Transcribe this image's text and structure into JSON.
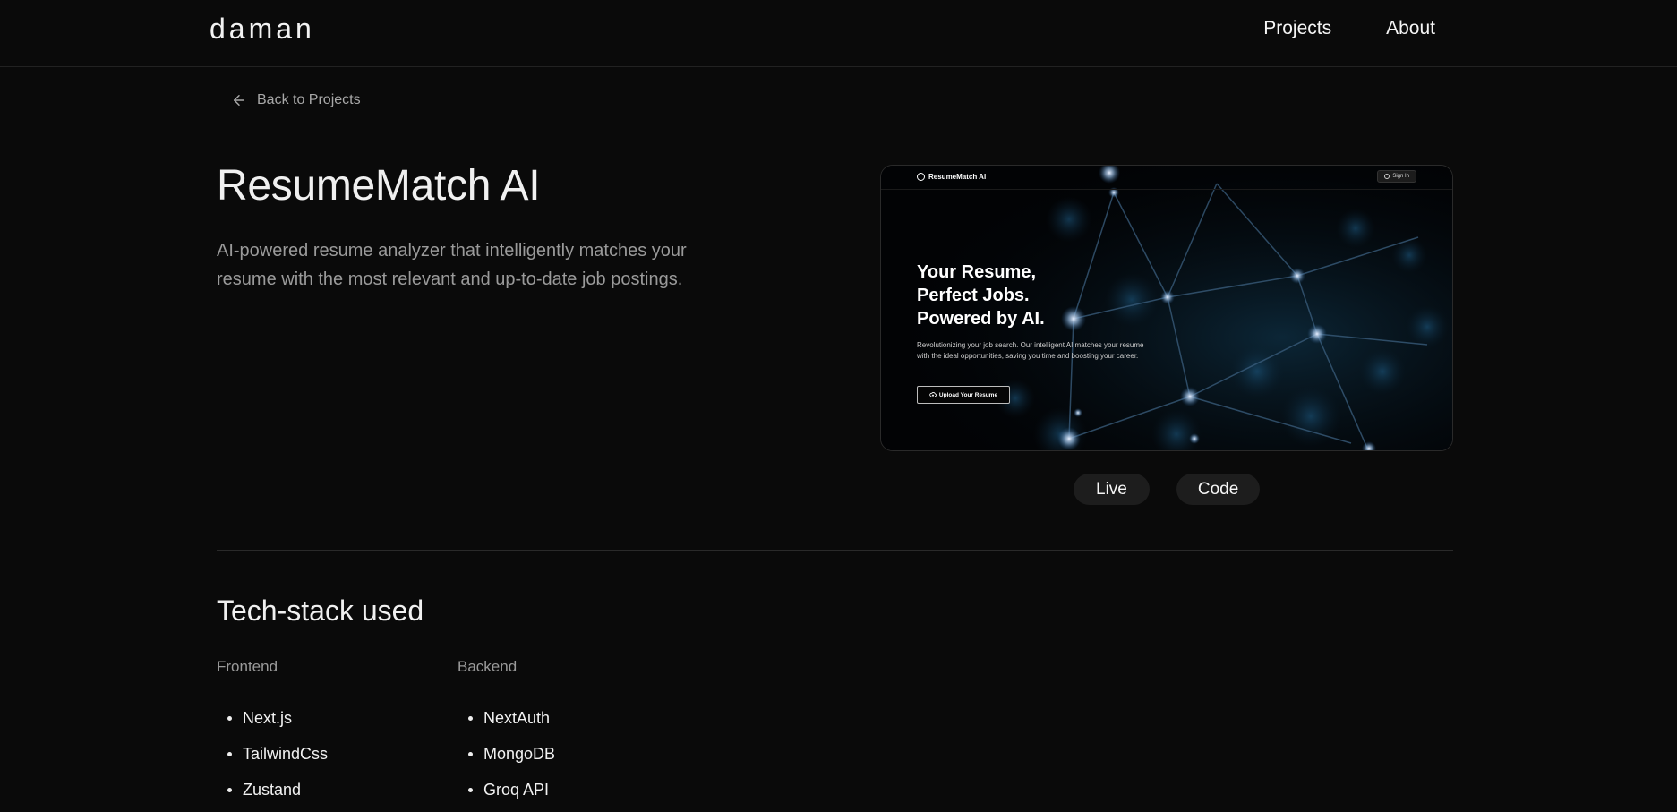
{
  "header": {
    "logo": "daman",
    "nav": [
      "Projects",
      "About"
    ]
  },
  "back_link": {
    "label": "Back to Projects",
    "icon": "arrow-left-icon"
  },
  "project": {
    "title": "ResumeMatch AI",
    "description": "AI-powered resume analyzer that intelligently matches your resume with the most relevant and up-to-date job postings."
  },
  "preview": {
    "brand": "ResumeMatch AI",
    "signin": "Sign In",
    "hero_lines": [
      "Your Resume,",
      "Perfect Jobs.",
      "Powered by AI."
    ],
    "subtitle": "Revolutionizing your job search. Our intelligent AI matches your resume with the ideal opportunities, saving you time and boosting your career.",
    "button": "Upload Your Resume"
  },
  "actions": {
    "live": "Live",
    "code": "Code"
  },
  "tech_stack": {
    "title": "Tech-stack used",
    "columns": [
      {
        "title": "Frontend",
        "items": [
          "Next.js",
          "TailwindCss",
          "Zustand"
        ]
      },
      {
        "title": "Backend",
        "items": [
          "NextAuth",
          "MongoDB",
          "Groq API"
        ]
      }
    ]
  },
  "colors": {
    "background": "#0a0a0a",
    "text": "#ececec",
    "muted": "#9a9a9a",
    "pill": "#1d1d1d"
  }
}
